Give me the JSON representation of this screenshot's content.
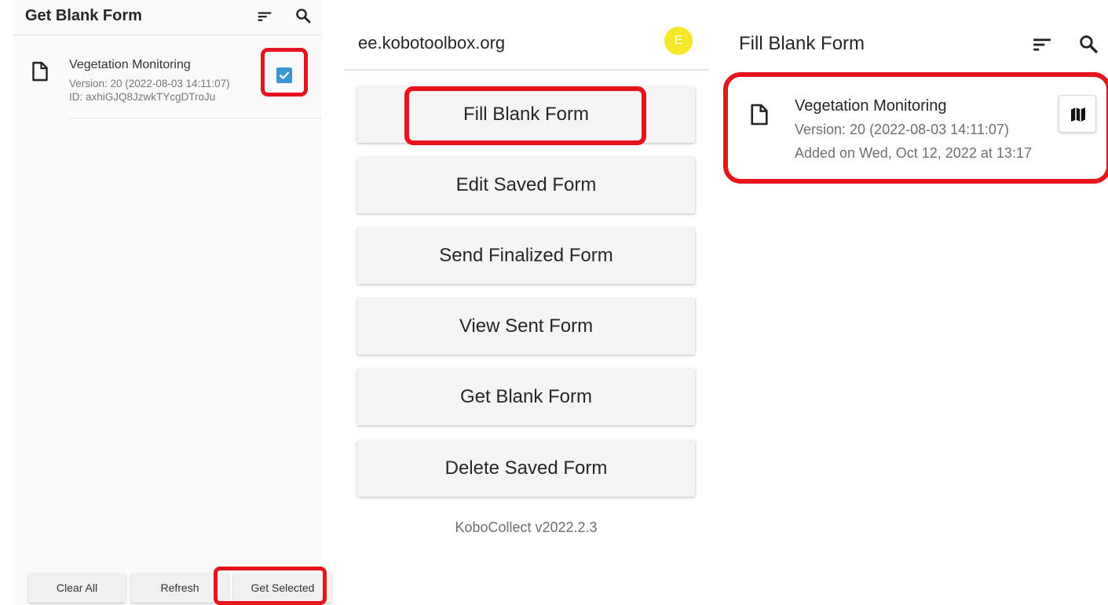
{
  "get_blank_form_screen": {
    "title": "Get Blank Form",
    "form": {
      "name": "Vegetation Monitoring",
      "version": "Version: 20 (2022-08-03 14:11:07)",
      "id": "ID: axhiGJQ8JzwkTYcgDTroJu",
      "selected": true
    },
    "buttons": {
      "clear_all": "Clear All",
      "refresh": "Refresh",
      "get_selected": "Get Selected"
    }
  },
  "main_menu_screen": {
    "server": "ee.kobotoolbox.org",
    "avatar_letter": "E",
    "menu": {
      "fill_blank_form": "Fill Blank Form",
      "edit_saved_form": "Edit Saved Form",
      "send_finalized_form": "Send Finalized Form",
      "view_sent_form": "View Sent Form",
      "get_blank_form": "Get Blank Form",
      "delete_saved_form": "Delete Saved Form"
    },
    "app_version": "KoboCollect v2022.2.3"
  },
  "fill_blank_form_screen": {
    "title": "Fill Blank Form",
    "form": {
      "name": "Vegetation Monitoring",
      "version": "Version: 20 (2022-08-03 14:11:07)",
      "added": "Added on Wed, Oct 12, 2022 at 13:17"
    }
  },
  "icons": {
    "sort": "sort-icon",
    "search": "search-icon",
    "document": "document-icon",
    "checkbox": "checkbox-checked-icon",
    "map": "map-icon"
  },
  "colors": {
    "highlight": "#e8141c",
    "checkbox": "#3a96d6",
    "avatar": "#f5e62a",
    "button_bg": "#f5f5f5"
  }
}
